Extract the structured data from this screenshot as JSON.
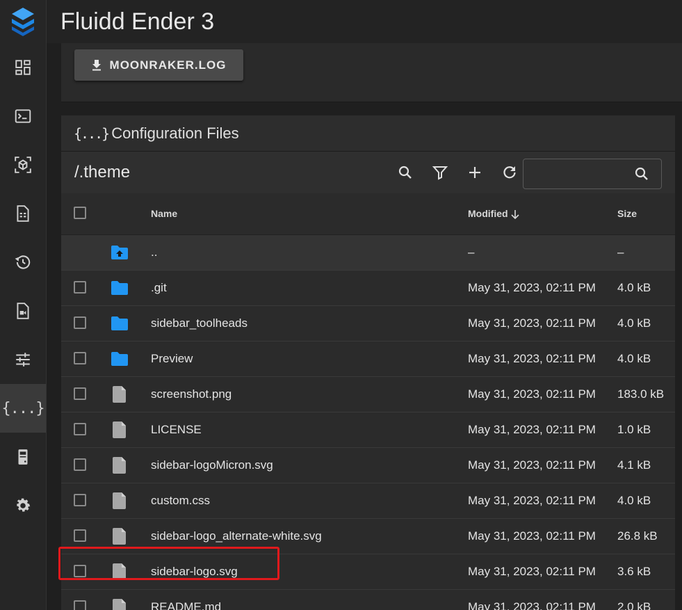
{
  "app": {
    "title": "Fluidd Ender 3"
  },
  "colors": {
    "accent": "#2196f3",
    "highlight": "#e0191c",
    "folder": "#2196f3",
    "file": "#a8a8a8"
  },
  "sidebar": {
    "items": [
      {
        "icon": "dashboard-icon"
      },
      {
        "icon": "console-icon"
      },
      {
        "icon": "3d-cube-icon"
      },
      {
        "icon": "file-table-icon"
      },
      {
        "icon": "history-icon"
      },
      {
        "icon": "video-file-icon"
      },
      {
        "icon": "tune-icon"
      },
      {
        "icon": "code-braces-icon",
        "label": "{...}",
        "active": true
      },
      {
        "icon": "printer-device-icon"
      },
      {
        "icon": "gear-icon"
      }
    ]
  },
  "top_card": {
    "log_button": "MOONRAKER.LOG"
  },
  "config": {
    "title": "Configuration Files",
    "title_prefix": "{...}",
    "path": "/.theme",
    "search_placeholder": ""
  },
  "table": {
    "headers": {
      "name": "Name",
      "modified": "Modified",
      "size": "Size"
    },
    "rows": [
      {
        "type": "parent",
        "name": "..",
        "modified": "–",
        "size": "–"
      },
      {
        "type": "folder",
        "name": ".git",
        "modified": "May 31, 2023, 02:11 PM",
        "size": "4.0 kB"
      },
      {
        "type": "folder",
        "name": "sidebar_toolheads",
        "modified": "May 31, 2023, 02:11 PM",
        "size": "4.0 kB"
      },
      {
        "type": "folder",
        "name": "Preview",
        "modified": "May 31, 2023, 02:11 PM",
        "size": "4.0 kB"
      },
      {
        "type": "file",
        "name": "screenshot.png",
        "modified": "May 31, 2023, 02:11 PM",
        "size": "183.0 kB"
      },
      {
        "type": "file",
        "name": "LICENSE",
        "modified": "May 31, 2023, 02:11 PM",
        "size": "1.0 kB"
      },
      {
        "type": "file",
        "name": "sidebar-logoMicron.svg",
        "modified": "May 31, 2023, 02:11 PM",
        "size": "4.1 kB"
      },
      {
        "type": "file",
        "name": "custom.css",
        "modified": "May 31, 2023, 02:11 PM",
        "size": "4.0 kB"
      },
      {
        "type": "file",
        "name": "sidebar-logo_alternate-white.svg",
        "modified": "May 31, 2023, 02:11 PM",
        "size": "26.8 kB"
      },
      {
        "type": "file",
        "name": "sidebar-logo.svg",
        "modified": "May 31, 2023, 02:11 PM",
        "size": "3.6 kB",
        "highlighted": true
      },
      {
        "type": "file",
        "name": "README.md",
        "modified": "May 31, 2023, 02:11 PM",
        "size": "2.0 kB"
      }
    ]
  }
}
